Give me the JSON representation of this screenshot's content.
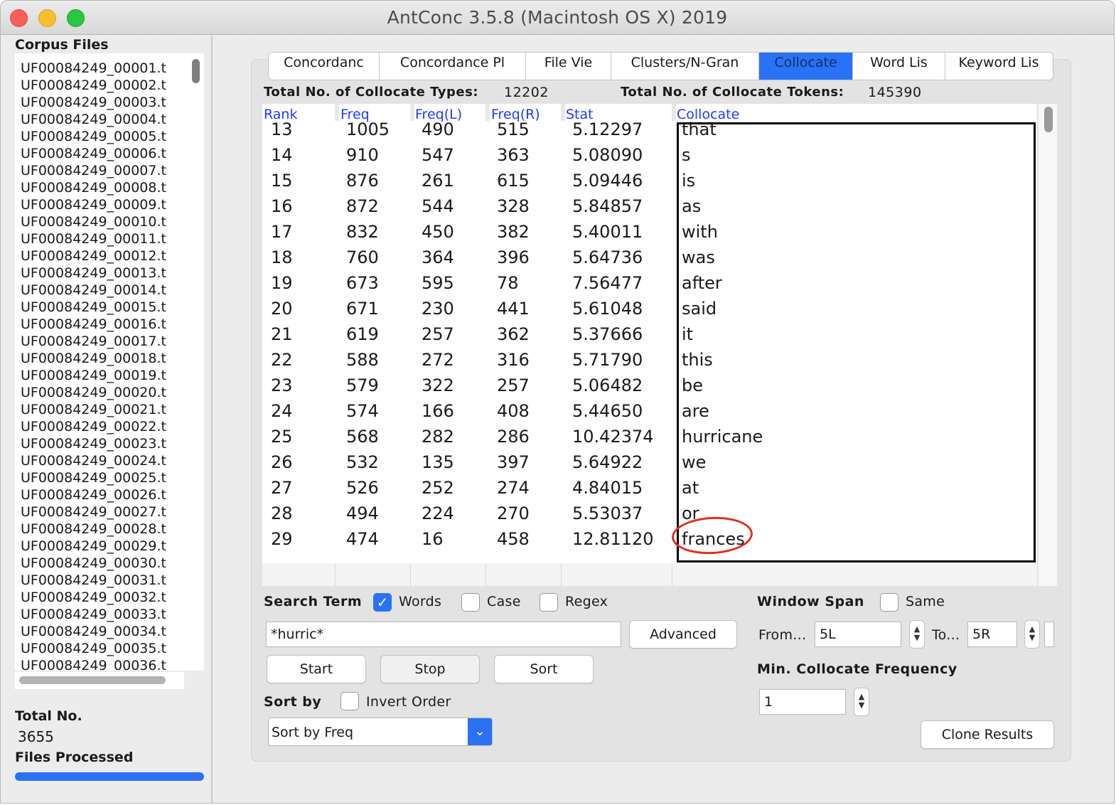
{
  "window": {
    "title": "AntConc 3.5.8 (Macintosh OS X) 2019"
  },
  "sidebar": {
    "heading": "Corpus Files",
    "files": [
      "UF00084249_00001.t",
      "UF00084249_00002.t",
      "UF00084249_00003.t",
      "UF00084249_00004.t",
      "UF00084249_00005.t",
      "UF00084249_00006.t",
      "UF00084249_00007.t",
      "UF00084249_00008.t",
      "UF00084249_00009.t",
      "UF00084249_00010.t",
      "UF00084249_00011.t",
      "UF00084249_00012.t",
      "UF00084249_00013.t",
      "UF00084249_00014.t",
      "UF00084249_00015.t",
      "UF00084249_00016.t",
      "UF00084249_00017.t",
      "UF00084249_00018.t",
      "UF00084249_00019.t",
      "UF00084249_00020.t",
      "UF00084249_00021.t",
      "UF00084249_00022.t",
      "UF00084249_00023.t",
      "UF00084249_00024.t",
      "UF00084249_00025.t",
      "UF00084249_00026.t",
      "UF00084249_00027.t",
      "UF00084249_00028.t",
      "UF00084249_00029.t",
      "UF00084249_00030.t",
      "UF00084249_00031.t",
      "UF00084249_00032.t",
      "UF00084249_00033.t",
      "UF00084249_00034.t",
      "UF00084249_00035.t",
      "UF00084249_00036.t"
    ],
    "total_label": "Total No.",
    "total_value": "3655",
    "processed_label": "Files Processed",
    "progress": 1.0
  },
  "tabs": [
    {
      "label": "Concordanc",
      "active": false
    },
    {
      "label": "Concordance Pl",
      "active": false
    },
    {
      "label": "File Vie",
      "active": false
    },
    {
      "label": "Clusters/N-Gran",
      "active": false
    },
    {
      "label": "Collocate",
      "active": true
    },
    {
      "label": "Word Lis",
      "active": false
    },
    {
      "label": "Keyword Lis",
      "active": false
    }
  ],
  "summary": {
    "types_label": "Total No. of Collocate Types:",
    "types_value": "12202",
    "tokens_label": "Total No. of Collocate Tokens:",
    "tokens_value": "145390"
  },
  "table": {
    "columns": [
      "Rank",
      "Freq",
      "Freq(L)",
      "Freq(R)",
      "Stat",
      "Collocate"
    ],
    "partial_row": [
      "13",
      "1005",
      "490",
      "515",
      "5.12297",
      "that"
    ],
    "rows": [
      [
        "14",
        "910",
        "547",
        "363",
        "5.08090",
        "s"
      ],
      [
        "15",
        "876",
        "261",
        "615",
        "5.09446",
        "is"
      ],
      [
        "16",
        "872",
        "544",
        "328",
        "5.84857",
        "as"
      ],
      [
        "17",
        "832",
        "450",
        "382",
        "5.40011",
        "with"
      ],
      [
        "18",
        "760",
        "364",
        "396",
        "5.64736",
        "was"
      ],
      [
        "19",
        "673",
        "595",
        "78",
        "7.56477",
        "after"
      ],
      [
        "20",
        "671",
        "230",
        "441",
        "5.61048",
        "said"
      ],
      [
        "21",
        "619",
        "257",
        "362",
        "5.37666",
        "it"
      ],
      [
        "22",
        "588",
        "272",
        "316",
        "5.71790",
        "this"
      ],
      [
        "23",
        "579",
        "322",
        "257",
        "5.06482",
        "be"
      ],
      [
        "24",
        "574",
        "166",
        "408",
        "5.44650",
        "are"
      ],
      [
        "25",
        "568",
        "282",
        "286",
        "10.42374",
        "hurricane"
      ],
      [
        "26",
        "532",
        "135",
        "397",
        "5.64922",
        "we"
      ],
      [
        "27",
        "526",
        "252",
        "274",
        "4.84015",
        "at"
      ],
      [
        "28",
        "494",
        "224",
        "270",
        "5.53037",
        "or"
      ],
      [
        "29",
        "474",
        "16",
        "458",
        "12.81120",
        "frances"
      ]
    ]
  },
  "search": {
    "label": "Search Term",
    "words_label": "Words",
    "words_checked": true,
    "case_label": "Case",
    "case_checked": false,
    "regex_label": "Regex",
    "regex_checked": false,
    "value": "*hurric*",
    "advanced_label": "Advanced",
    "start_label": "Start",
    "stop_label": "Stop",
    "sort_label": "Sort"
  },
  "window_span": {
    "label": "Window Span",
    "same_label": "Same",
    "same_checked": false,
    "from_label": "From...",
    "from_value": "5L",
    "to_label": "To...",
    "to_value": "5R"
  },
  "min_freq": {
    "label": "Min. Collocate Frequency",
    "value": "1"
  },
  "sort": {
    "label": "Sort by",
    "invert_label": "Invert Order",
    "invert_checked": false,
    "selected": "Sort by Freq"
  },
  "clone_label": "Clone Results",
  "colors": {
    "accent": "#2a72f5",
    "header_link": "#1b3bff",
    "annotation": "#e0301e"
  }
}
